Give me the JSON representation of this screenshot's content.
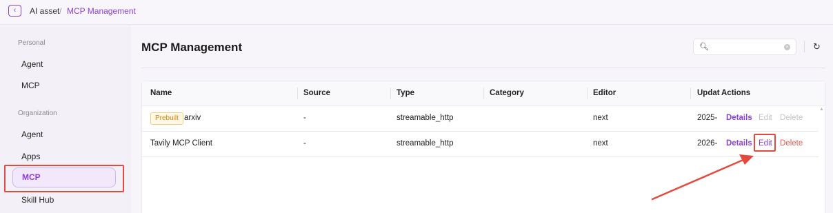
{
  "breadcrumb": {
    "back_icon": "chevron-left-icon",
    "items": [
      "AI asset",
      "MCP Management"
    ],
    "separator": "/"
  },
  "sidebar": {
    "personal_label": "Personal",
    "personal_items": [
      "Agent",
      "MCP"
    ],
    "organization_label": "Organization",
    "organization_items": [
      "Agent",
      "Apps",
      "MCP",
      "Skill Hub"
    ],
    "active_item": "MCP"
  },
  "main": {
    "title": "MCP Management",
    "search_placeholder": "",
    "refresh_icon": "refresh-icon",
    "columns": [
      "Name",
      "Source",
      "Type",
      "Category",
      "Editor",
      "Updat",
      "Actions"
    ],
    "rows": [
      {
        "badge": "Prebuilt",
        "name": "arxiv",
        "source": "-",
        "type": "streamable_http",
        "category": "",
        "editor": "next",
        "updated": "2025-",
        "actions": {
          "details": "Details",
          "edit": "Edit",
          "delete": "Delete"
        },
        "editable": false
      },
      {
        "badge": "",
        "name": "Tavily MCP Client",
        "source": "-",
        "type": "streamable_http",
        "category": "",
        "editor": "next",
        "updated": "2026-",
        "actions": {
          "details": "Details",
          "edit": "Edit",
          "delete": "Delete"
        },
        "editable": true
      }
    ]
  },
  "colors": {
    "accent": "#8b3fd9",
    "annotation": "#e34a3d",
    "delete": "#e8584c",
    "badge_text": "#c88a12"
  }
}
